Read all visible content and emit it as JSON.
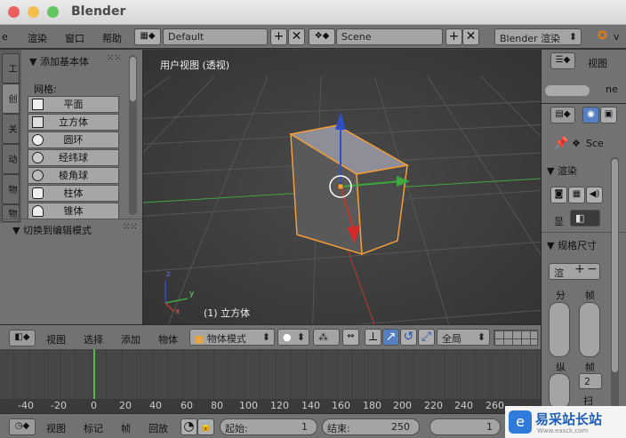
{
  "window": {
    "title": "Blender"
  },
  "info_header": {
    "menus": [
      "渲染",
      "窗口",
      "帮助"
    ],
    "menu_partial": "e",
    "screen_layout": "Default",
    "scene": "Scene",
    "engine": "Blender 渲染",
    "version_partial": "v"
  },
  "tool_shelf": {
    "tabs": [
      "工",
      "创",
      "关",
      "动",
      "物",
      "物"
    ],
    "add_primitive_header": "▼ 添加基本体",
    "mesh_label": "网格:",
    "mesh_buttons": [
      "平面",
      "立方体",
      "圆环",
      "经纬球",
      "棱角球",
      "柱体",
      "锥体"
    ],
    "edit_mode_header": "▼ 切换到编辑模式"
  },
  "viewport": {
    "view_label": "用户视图 (透视)",
    "object_label": "(1) 立方体",
    "axis_x": "x",
    "axis_y": "y",
    "axis_z": "z"
  },
  "view3d_header": {
    "menus": [
      "视图",
      "选择",
      "添加",
      "物体"
    ],
    "mode": "物体模式",
    "pivot": "全局"
  },
  "timeline": {
    "ticks": [
      "-40",
      "-20",
      "0",
      "20",
      "40",
      "60",
      "80",
      "100",
      "120",
      "140",
      "160",
      "180",
      "200",
      "220",
      "240",
      "260"
    ],
    "current_frame": 1
  },
  "timeline_header": {
    "menus": [
      "视图",
      "标记",
      "帧",
      "回放"
    ],
    "start_label": "起始:",
    "start_value": "1",
    "end_label": "结束:",
    "end_value": "250",
    "current_value": "1"
  },
  "outliner": {
    "view_label": "视图",
    "partial_text": "ne"
  },
  "properties": {
    "scene_partial": "Sce",
    "render_header": "▼ 渲染",
    "display_label": "显",
    "dimensions_header": "▼ 规格尺寸",
    "preset_partial": "渲",
    "col_label_1": "分",
    "col_label_2": "帧",
    "col_label_3": "纵",
    "col_label_4": "帧",
    "frame_step": "2",
    "bottom_partial": "扫"
  },
  "watermark": {
    "text": "易采站长站",
    "subtext": "Www.easck.com"
  },
  "colors": {
    "close": "#ec5f5f",
    "minimize": "#f6be4f",
    "maximize": "#5ec75e",
    "panel": "#727272",
    "viewport": "#3a3a3a",
    "selection": "#f29d38",
    "axis_x": "#c0392b",
    "axis_y": "#3ea73e",
    "axis_z": "#2f4fc9",
    "current_frame": "#52b84a"
  }
}
